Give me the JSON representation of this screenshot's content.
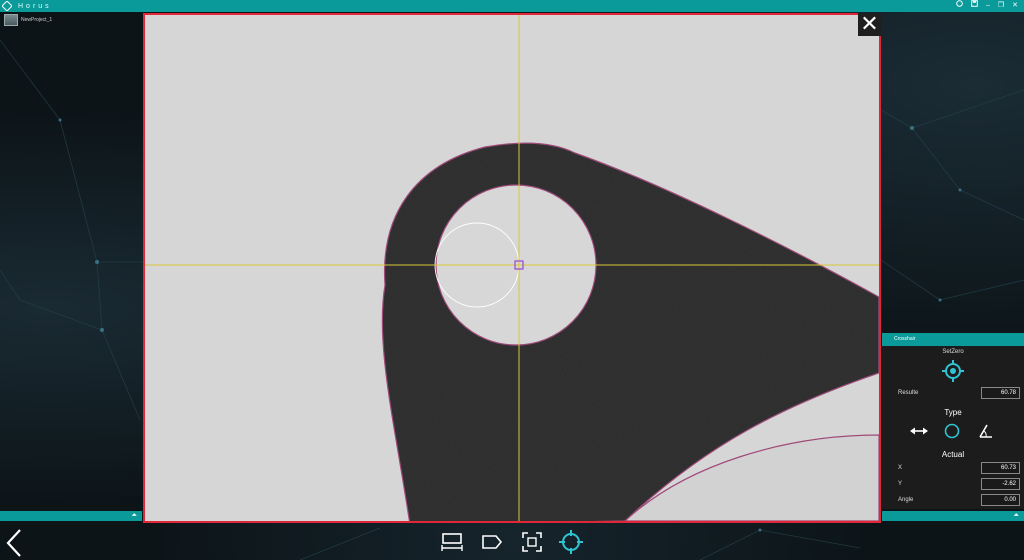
{
  "app": {
    "title": "Horus",
    "project_name": "NewProject_1"
  },
  "window_controls": {
    "help_icon": "help-icon",
    "save_icon": "save-icon",
    "minimize": "–",
    "restore": "❐",
    "close": "✕"
  },
  "viewport": {
    "close_label": "✕",
    "border_color": "#e0273a",
    "crosshair_color": "#d8c73a"
  },
  "crosshair_panel": {
    "header": "Crosshair",
    "set_zero_label": "SetZero",
    "result_label": "Resulte",
    "result_value": "60.78",
    "type_label": "Type",
    "actual_label": "Actual",
    "x_label": "X",
    "x_value": "60.73",
    "y_label": "Y",
    "y_value": "-2.62",
    "angle_label": "Angle",
    "angle_value": "0.00"
  },
  "side_bars": {
    "caret": "⏶"
  },
  "toolbar": {
    "back_icon": "chevron-left-icon",
    "tools": [
      "measure-width-icon",
      "tag-icon",
      "select-region-icon",
      "crosshair-icon"
    ]
  },
  "colors": {
    "accent": "#0a9a9a",
    "active_tool": "#2fc3d3"
  }
}
